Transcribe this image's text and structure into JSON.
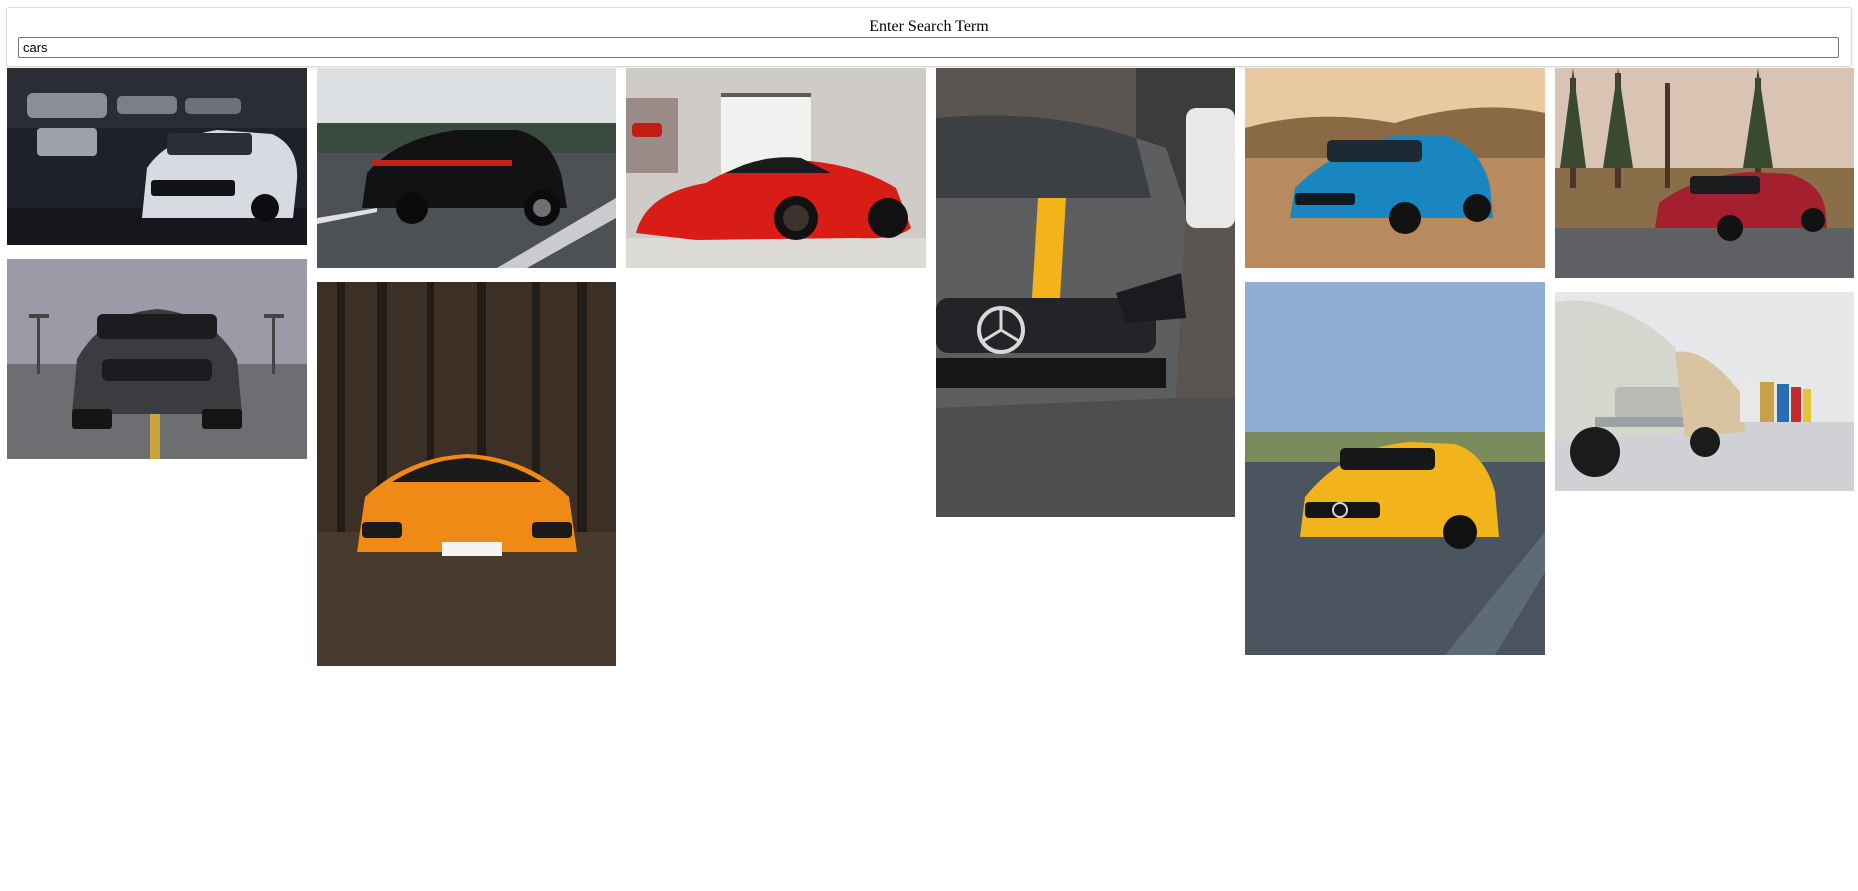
{
  "search": {
    "label": "Enter Search Term",
    "value": "cars"
  },
  "colors": {
    "panel_border": "#dcdcdc",
    "input_border": "#767676",
    "background": "#ffffff"
  },
  "gallery": {
    "results": [
      {
        "car_color": "#e8eaee",
        "scene": "dark-garage"
      },
      {
        "car_color": "#121214",
        "scene": "road"
      },
      {
        "car_color": "#d81c16",
        "scene": "showroom"
      },
      {
        "car_color": "#5d5e60",
        "scene": "street"
      },
      {
        "car_color": "#1986c2",
        "scene": "desert"
      },
      {
        "car_color": "#a4202e",
        "scene": "forest-lot"
      },
      {
        "car_color": "#3a3c40",
        "scene": "parking-lot"
      },
      {
        "car_color": "#f08a16",
        "scene": "dark-forest"
      },
      {
        "car_color": "#f3b31a",
        "scene": "sunny-road"
      },
      {
        "car_color": "#d5d7cf",
        "scene": "museum"
      }
    ]
  }
}
